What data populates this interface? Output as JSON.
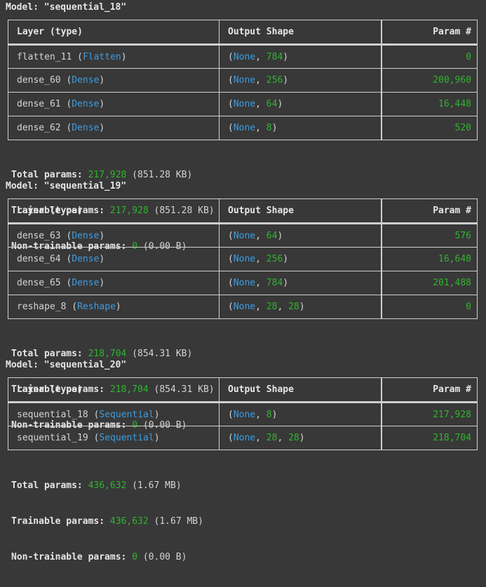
{
  "headers": {
    "layer": "Layer (type)",
    "output": "Output Shape",
    "param": "Param #"
  },
  "labels": {
    "model_prefix": "Model: ",
    "total": "Total params: ",
    "trainable": "Trainable params: ",
    "non_trainable": "Non-trainable params: "
  },
  "models": [
    {
      "name": "\"sequential_18\"",
      "layers": [
        {
          "name": "flatten_11",
          "type": "Flatten",
          "shape": [
            "None",
            "784"
          ],
          "params": "0"
        },
        {
          "name": "dense_60",
          "type": "Dense",
          "shape": [
            "None",
            "256"
          ],
          "params": "200,960"
        },
        {
          "name": "dense_61",
          "type": "Dense",
          "shape": [
            "None",
            "64"
          ],
          "params": "16,448"
        },
        {
          "name": "dense_62",
          "type": "Dense",
          "shape": [
            "None",
            "8"
          ],
          "params": "520"
        }
      ],
      "total": {
        "count": "217,928",
        "size": "(851.28 KB)"
      },
      "trainable": {
        "count": "217,928",
        "size": "(851.28 KB)"
      },
      "non_trainable": {
        "count": "0",
        "size": "(0.00 B)"
      }
    },
    {
      "name": "\"sequential_19\"",
      "layers": [
        {
          "name": "dense_63",
          "type": "Dense",
          "shape": [
            "None",
            "64"
          ],
          "params": "576"
        },
        {
          "name": "dense_64",
          "type": "Dense",
          "shape": [
            "None",
            "256"
          ],
          "params": "16,640"
        },
        {
          "name": "dense_65",
          "type": "Dense",
          "shape": [
            "None",
            "784"
          ],
          "params": "201,488"
        },
        {
          "name": "reshape_8",
          "type": "Reshape",
          "shape": [
            "None",
            "28",
            "28"
          ],
          "params": "0"
        }
      ],
      "total": {
        "count": "218,704",
        "size": "(854.31 KB)"
      },
      "trainable": {
        "count": "218,704",
        "size": "(854.31 KB)"
      },
      "non_trainable": {
        "count": "0",
        "size": "(0.00 B)"
      }
    },
    {
      "name": "\"sequential_20\"",
      "layers": [
        {
          "name": "sequential_18",
          "type": "Sequential",
          "shape": [
            "None",
            "8"
          ],
          "params": "217,928"
        },
        {
          "name": "sequential_19",
          "type": "Sequential",
          "shape": [
            "None",
            "28",
            "28"
          ],
          "params": "218,704"
        }
      ],
      "total": {
        "count": "436,632",
        "size": "(1.67 MB)"
      },
      "trainable": {
        "count": "436,632",
        "size": "(1.67 MB)"
      },
      "non_trainable": {
        "count": "0",
        "size": "(0.00 B)"
      }
    }
  ]
}
